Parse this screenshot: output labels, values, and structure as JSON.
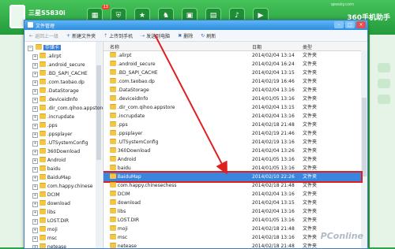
{
  "app": {
    "device_name": "三星S5830i",
    "badge": "13",
    "site_logo": "qeesky.com",
    "brand": "360手机助手",
    "icons": [
      "apps-icon",
      "shield-icon",
      "star-icon",
      "games-icon",
      "bag-icon",
      "images-icon",
      "music-icon",
      "video-icon"
    ]
  },
  "window": {
    "title": "文件管理",
    "buttons": [
      "minimize",
      "maximize",
      "close"
    ]
  },
  "toolbar": [
    {
      "label": "返回上一级",
      "icon": "back-icon",
      "enabled": false
    },
    {
      "label": "新建文件夹",
      "icon": "plus-icon",
      "enabled": true
    },
    {
      "label": "上传到手机",
      "icon": "upload-icon",
      "enabled": true
    },
    {
      "label": "发送到电脑",
      "icon": "send-icon",
      "enabled": true
    },
    {
      "label": "删除",
      "icon": "delete-icon",
      "enabled": true
    },
    {
      "label": "刷新",
      "icon": "refresh-icon",
      "enabled": true
    }
  ],
  "tree": {
    "root": "存储卡",
    "items": [
      ".alirpt",
      ".android_secure",
      ".BD_SAPI_CACHE",
      ".com.taobao.dp",
      ".DataStorage",
      ".deviceidInfo",
      ".dir_com.qihoo.appstore",
      ".incrupdate",
      ".pps",
      ".ppsplayer",
      ".UTSystemConfig",
      "360Download",
      "Android",
      "baidu",
      "BaiduMap",
      "com.happy.chinese",
      "DCIM",
      "download",
      "libs",
      "LOST.DIR",
      "moji",
      "msc",
      "netease"
    ]
  },
  "list": {
    "headers": {
      "name": "名称",
      "date": "日期",
      "type": "类型"
    },
    "rows": [
      {
        "name": ".alirpt",
        "date": "2014/02/04 13:14",
        "type": "文件夹"
      },
      {
        "name": ".android_secure",
        "date": "2014/02/04 16:24",
        "type": "文件夹"
      },
      {
        "name": ".BD_SAPI_CACHE",
        "date": "2014/02/04 13:15",
        "type": "文件夹"
      },
      {
        "name": ".com.taobao.dp",
        "date": "2014/02/19 16:46",
        "type": "文件夹"
      },
      {
        "name": ".DataStorage",
        "date": "2014/02/04 13:16",
        "type": "文件夹"
      },
      {
        "name": ".deviceidInfo",
        "date": "2014/01/05 13:16",
        "type": "文件夹"
      },
      {
        "name": ".dir_com.qihoo.appstore",
        "date": "2014/02/04 13:15",
        "type": "文件夹"
      },
      {
        "name": ".incrupdate",
        "date": "2014/02/04 13:16",
        "type": "文件夹"
      },
      {
        "name": ".pps",
        "date": "2014/02/18 21:48",
        "type": "文件夹"
      },
      {
        "name": ".ppsplayer",
        "date": "2014/02/19 21:46",
        "type": "文件夹"
      },
      {
        "name": ".UTSystemConfig",
        "date": "2014/02/19 13:16",
        "type": "文件夹"
      },
      {
        "name": "360Download",
        "date": "2014/02/04 13:26",
        "type": "文件夹"
      },
      {
        "name": "Android",
        "date": "2014/01/05 13:16",
        "type": "文件夹"
      },
      {
        "name": "baidu",
        "date": "2014/01/05 13:16",
        "type": "文件夹"
      },
      {
        "name": "BaiduMap",
        "date": "2014/02/10 22:26",
        "type": "文件夹",
        "selected": true
      },
      {
        "name": "com.happy.chinesechess",
        "date": "2014/02/18 21:48",
        "type": "文件夹"
      },
      {
        "name": "DCIM",
        "date": "2014/02/04 13:16",
        "type": "文件夹"
      },
      {
        "name": "download",
        "date": "2014/02/04 13:15",
        "type": "文件夹"
      },
      {
        "name": "libs",
        "date": "2014/02/04 13:16",
        "type": "文件夹"
      },
      {
        "name": "LOST.DIR",
        "date": "2014/01/05 13:16",
        "type": "文件夹"
      },
      {
        "name": "moji",
        "date": "2014/02/18 21:48",
        "type": "文件夹"
      },
      {
        "name": "msc",
        "date": "2014/02/18 13:16",
        "type": "文件夹"
      },
      {
        "name": "netease",
        "date": "2014/02/18 21:48",
        "type": "文件夹"
      }
    ]
  },
  "watermark": "PConline"
}
